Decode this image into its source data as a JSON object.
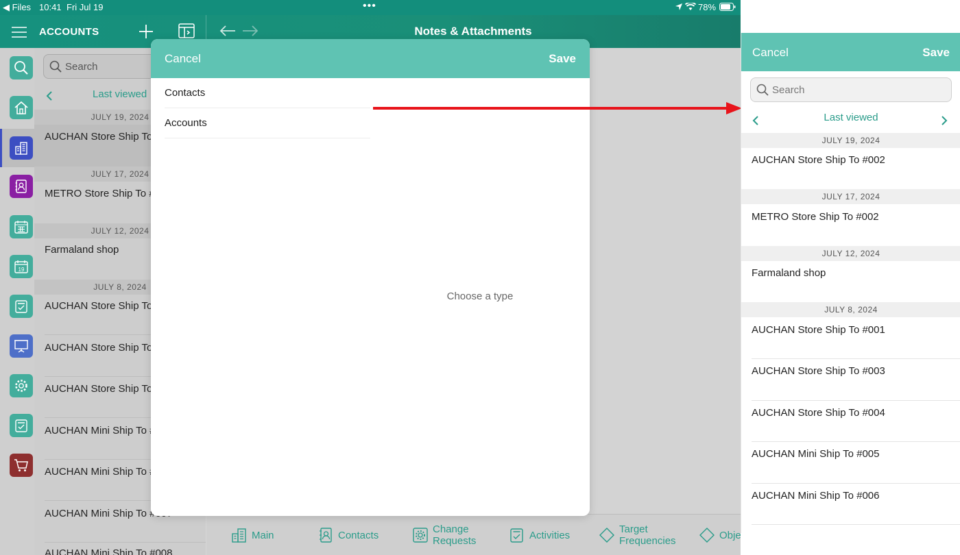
{
  "status_bar": {
    "back_app": "◀ Files",
    "time": "10:41",
    "date": "Fri Jul 19",
    "battery": "78%"
  },
  "header": {
    "section_title": "ACCOUNTS",
    "page_title": "Notes & Attachments"
  },
  "list_pane": {
    "search_placeholder": "Search",
    "nav_label": "Last viewed",
    "sections": [
      "JULY 19, 2024",
      "JULY 17, 2024",
      "JULY 12, 2024",
      "JULY 8, 2024"
    ],
    "rows": [
      "AUCHAN Store Ship To",
      "METRO Store Ship To #",
      "Farmaland shop",
      "AUCHAN Store Ship To",
      "AUCHAN Store Ship To",
      "AUCHAN Store Ship To",
      "AUCHAN Mini Ship To #",
      "AUCHAN Mini Ship To #",
      "AUCHAN Mini Ship To #007",
      "AUCHAN Mini Ship To #008"
    ]
  },
  "modal": {
    "cancel_label": "Cancel",
    "save_label": "Save",
    "options": [
      "Contacts",
      "Accounts"
    ],
    "empty_text": "Choose a type"
  },
  "bottom_tabs": {
    "main": "Main",
    "contacts": "Contacts",
    "change_requests_1": "Change",
    "change_requests_2": "Requests",
    "activities": "Activities",
    "target_1": "Target",
    "target_2": "Frequencies",
    "objectives": "Obje"
  },
  "zoom_panel": {
    "cancel_label": "Cancel",
    "save_label": "Save",
    "search_placeholder": "Search",
    "nav_label": "Last viewed",
    "sections": [
      "JULY 19, 2024",
      "JULY 17, 2024",
      "JULY 12, 2024",
      "JULY 8, 2024"
    ],
    "rows": [
      "AUCHAN Store Ship To #002",
      "METRO Store Ship To #002",
      "Farmaland shop",
      "AUCHAN Store Ship To #001",
      "AUCHAN Store Ship To #003",
      "AUCHAN Store Ship To #004",
      "AUCHAN Mini Ship To #005",
      "AUCHAN Mini Ship To #006"
    ]
  },
  "colors": {
    "brand_teal": "#16917e",
    "modal_header": "#5fc3b3",
    "accent_text": "#2a9c8a",
    "arrow_red": "#e8141b",
    "active_rail": "#3c4ec2"
  },
  "icons": [
    "menu-icon",
    "plus-icon",
    "split-view-icon",
    "back-arrow-icon",
    "forward-arrow-icon",
    "more-dots-icon",
    "location-icon",
    "wifi-icon",
    "battery-icon",
    "search-icon",
    "home-icon",
    "accounts-icon",
    "contacts-icon",
    "calendar-icon",
    "calendar-day-icon",
    "checklist-icon",
    "presentation-icon",
    "settings-icon",
    "cart-icon",
    "chevron-left-icon",
    "chevron-right-icon"
  ]
}
